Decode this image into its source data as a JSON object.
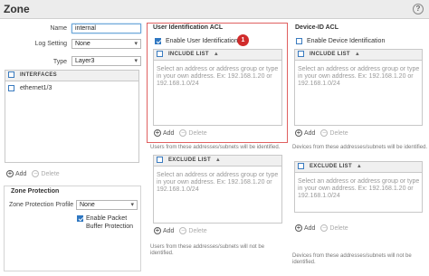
{
  "window": {
    "title": "Zone",
    "help_icon": "?"
  },
  "form": {
    "name_label": "Name",
    "name_value": "internal",
    "log_setting_label": "Log Setting",
    "log_setting_value": "None",
    "type_label": "Type",
    "type_value": "Layer3"
  },
  "interfaces": {
    "header": "INTERFACES",
    "items": [
      "ethernet1/3"
    ],
    "add_label": "Add",
    "delete_label": "Delete"
  },
  "zone_protection": {
    "title": "Zone Protection",
    "profile_label": "Zone Protection Profile",
    "profile_value": "None",
    "packet_buffer_label_1": "Enable Packet",
    "packet_buffer_label_2": "Buffer Protection"
  },
  "user_id_acl": {
    "title": "User Identification ACL",
    "enable_label": "Enable User Identification",
    "enable_checked": true,
    "badge": "1",
    "include_header": "INCLUDE LIST",
    "include_placeholder": [
      "Select an address or address group or type",
      "in your own address.  Ex: 192.168.1.20 or",
      "192.168.1.0/24"
    ],
    "add_label": "Add",
    "delete_label": "Delete",
    "include_hint": "Users from these addresses/subnets will be identified.",
    "exclude_header": "EXCLUDE LIST",
    "exclude_placeholder": [
      "Select an address or address group or type",
      "in your own address.  Ex: 192.168.1.20 or",
      "192.168.1.0/24"
    ],
    "exclude_hint_1": "Users from these addresses/subnets will not be",
    "exclude_hint_2": "identified."
  },
  "device_id_acl": {
    "title": "Device-ID ACL",
    "enable_label": "Enable Device Identification",
    "enable_checked": false,
    "include_header": "INCLUDE LIST",
    "include_placeholder": [
      "Select an address or address group or type",
      "in your own address.  Ex: 192.168.1.20 or",
      "192.168.1.0/24"
    ],
    "add_label": "Add",
    "delete_label": "Delete",
    "include_hint": "Devices from these addresses/subnets will be identified.",
    "exclude_header": "EXCLUDE LIST",
    "exclude_placeholder": [
      "Select an address or address group or type",
      "in your own address.  Ex: 192.168.1.20 or",
      "192.168.1.0/24"
    ],
    "exclude_hint_1": "Devices from these addresses/subnets will not be",
    "exclude_hint_2": "identified."
  }
}
